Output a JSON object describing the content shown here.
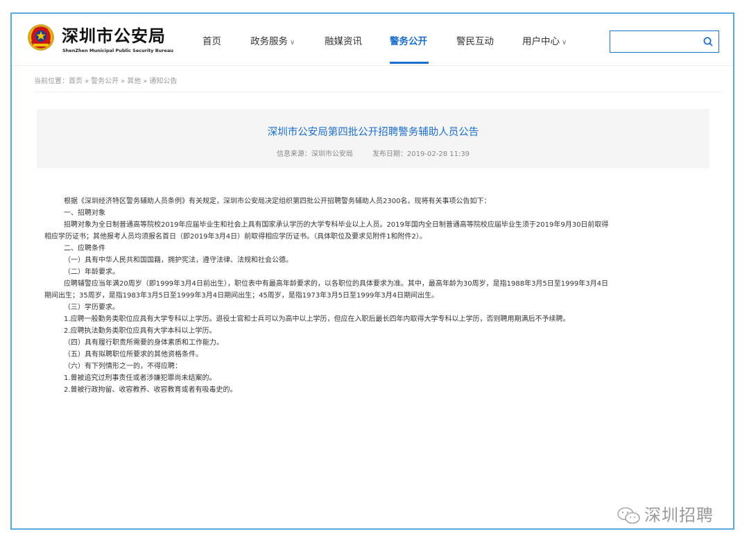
{
  "header": {
    "brand_title": "深圳市公安局",
    "brand_subtitle": "ShenZhen Municipal Public Security Bureau",
    "nav": [
      {
        "label": "首页",
        "caret": false,
        "active": false
      },
      {
        "label": "政务服务",
        "caret": true,
        "active": false
      },
      {
        "label": "融媒资讯",
        "caret": false,
        "active": false
      },
      {
        "label": "警务公开",
        "caret": false,
        "active": true
      },
      {
        "label": "警民互动",
        "caret": false,
        "active": false
      },
      {
        "label": "用户中心",
        "caret": true,
        "active": false
      }
    ],
    "search": {
      "value": "",
      "placeholder": ""
    }
  },
  "breadcrumb": {
    "prefix": "当前位置：",
    "items": [
      "首页",
      "警务公开",
      "其他",
      "通知公告"
    ],
    "separator": "»"
  },
  "article": {
    "title": "深圳市公安局第四批公开招聘警务辅助人员公告",
    "source_label": "信息来源：深圳市公安局",
    "date_label": "发布日期：2019-02-28 11:39"
  },
  "content": {
    "paragraphs": [
      "根据《深圳经济特区警务辅助人员条例》有关规定，深圳市公安局决定组织第四批公开招聘警务辅助人员2300名。现将有关事项公告如下：",
      "一、招聘对象",
      "招聘对象为全日制普通高等院校2019年应届毕业生和社会上具有国家承认学历的大学专科毕业以上人员。2019年国内全日制普通高等院校应届毕业生须于2019年9月30日前取得",
      "相应学历证书；其他报考人员均须报名首日（即2019年3月4日）前取得相应学历证书。（具体职位及要求见附件1和附件2）。",
      "二、应聘条件",
      "（一）具有中华人民共和国国籍，拥护宪法，遵守法律、法规和社会公德。",
      "（二）年龄要求。",
      "应聘辅警应当年满20周岁（即1999年3月4日前出生），职位表中有最高年龄要求的，以各职位的具体要求为准。其中，最高年龄为30周岁，是指1988年3月5日至1999年3月4日",
      "期间出生；35周岁，是指1983年3月5日至1999年3月4日期间出生；45周岁，是指1973年3月5日至1999年3月4日期间出生。",
      "（三）学历要求。",
      "1.应聘一般勤务类职位应具有大学专科以上学历。退役士官和士兵可以为高中以上学历，但应在入职后最长四年内取得大学专科以上学历，否则聘用期满后不予续聘。",
      "2.应聘执法勤务类职位应具有大学本科以上学历。",
      "（四）具有履行职责所需要的身体素质和工作能力。",
      "（五）具有拟聘职位所要求的其他资格条件。",
      "（六）有下列情形之一的，不得应聘：",
      "1.曾被追究过刑事责任或者涉嫌犯罪尚未结案的。",
      "2.曾被行政拘留、收容教养、收容教育或者有吸毒史的。"
    ]
  },
  "watermark": {
    "text": "深圳招聘",
    "icon": "wechat-icon"
  },
  "colors": {
    "accent": "#1a6fce",
    "frame_border": "#5aa9dd",
    "title_box_bg": "#f5f5f5"
  },
  "icons": {
    "logo": "police-emblem-icon",
    "search": "search-icon"
  }
}
